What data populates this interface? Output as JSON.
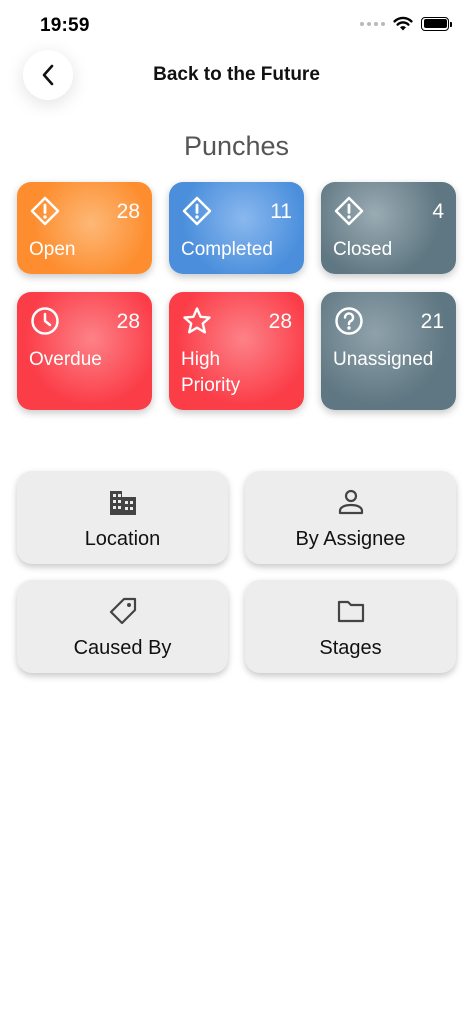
{
  "status_bar": {
    "time": "19:59"
  },
  "nav": {
    "back_icon": "chevron-left-icon",
    "title": "Back to the Future"
  },
  "section_title": "Punches",
  "tiles": [
    {
      "label": "Open",
      "count": "28",
      "icon": "alert-diamond-icon",
      "color": "#fd8d2e"
    },
    {
      "label": "Completed",
      "count": "11",
      "icon": "alert-diamond-icon",
      "color": "#4b8fdc"
    },
    {
      "label": "Closed",
      "count": "4",
      "icon": "alert-diamond-icon",
      "color": "#5f7782"
    },
    {
      "label": "Overdue",
      "count": "28",
      "icon": "clock-icon",
      "color": "#fb3d48"
    },
    {
      "label": "High Priority",
      "count": "28",
      "icon": "star-icon",
      "color": "#fb3d48"
    },
    {
      "label": "Unassigned",
      "count": "21",
      "icon": "help-circle-icon",
      "color": "#5f7782"
    }
  ],
  "categories": [
    {
      "label": "Location",
      "icon": "building-icon"
    },
    {
      "label": "By Assignee",
      "icon": "person-icon"
    },
    {
      "label": "Caused By",
      "icon": "tag-icon"
    },
    {
      "label": "Stages",
      "icon": "folder-icon"
    }
  ]
}
